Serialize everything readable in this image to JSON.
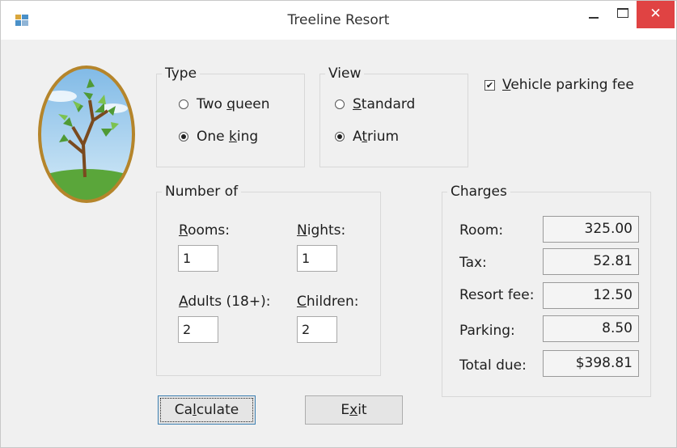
{
  "window": {
    "title": "Treeline Resort"
  },
  "type_group": {
    "legend": "Type",
    "options": [
      {
        "pre": "Two ",
        "mnemonic": "q",
        "post": "ueen",
        "selected": false
      },
      {
        "pre": "One ",
        "mnemonic": "k",
        "post": "ing",
        "selected": true
      }
    ]
  },
  "view_group": {
    "legend": "View",
    "options": [
      {
        "pre": "",
        "mnemonic": "S",
        "post": "tandard",
        "selected": false
      },
      {
        "pre": "A",
        "mnemonic": "t",
        "post": "rium",
        "selected": true
      }
    ]
  },
  "parking_checkbox": {
    "pre": "",
    "mnemonic": "V",
    "post": "ehicle parking fee",
    "checked": true,
    "mark": "✔"
  },
  "number_group": {
    "legend": "Number of",
    "rooms": {
      "pre": "",
      "mnemonic": "R",
      "post": "ooms:",
      "value": "1"
    },
    "nights": {
      "pre": "",
      "mnemonic": "N",
      "post": "ights:",
      "value": "1"
    },
    "adults": {
      "pre": "",
      "mnemonic": "A",
      "post": "dults (18+):",
      "value": "2"
    },
    "children": {
      "pre": "",
      "mnemonic": "C",
      "post": "hildren:",
      "value": "2"
    }
  },
  "charges_group": {
    "legend": "Charges",
    "rows": [
      {
        "label": "Room:",
        "value": "325.00"
      },
      {
        "label": "Tax:",
        "value": "52.81"
      },
      {
        "label": "Resort fee:",
        "value": "12.50"
      },
      {
        "label": "Parking:",
        "value": "8.50"
      },
      {
        "label": "Total due:",
        "value": "$398.81"
      }
    ]
  },
  "buttons": {
    "calculate": {
      "pre": "Ca",
      "mnemonic": "l",
      "post": "culate"
    },
    "exit": {
      "pre": "E",
      "mnemonic": "x",
      "post": "it"
    }
  },
  "titlebar_buttons": {
    "close": "✕"
  },
  "colors": {
    "close_button": "#e04343",
    "logo_border": "#b5852b",
    "sky": "#a9d3ef",
    "grass": "#5aa63a"
  }
}
